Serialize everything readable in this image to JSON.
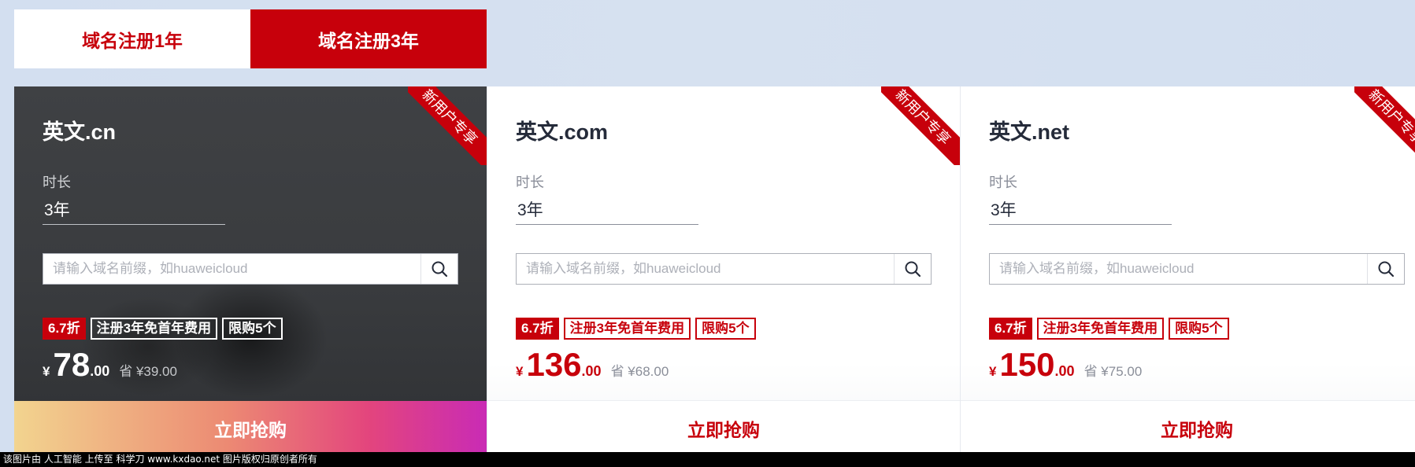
{
  "tabs": [
    {
      "label": "域名注册1年",
      "active": false
    },
    {
      "label": "域名注册3年",
      "active": true
    }
  ],
  "ribbon_text": "新用户专享",
  "duration_label": "时长",
  "search_placeholder": "请输入域名前缀，如huaweicloud",
  "buy_label": "立即抢购",
  "cards": [
    {
      "title": "英文.cn",
      "duration": "3年",
      "discount_tag": "6.7折",
      "tag_free": "注册3年免首年费用",
      "tag_limit": "限购5个",
      "currency": "¥",
      "price_int": "78",
      "price_dec": ".00",
      "save": "省 ¥39.00"
    },
    {
      "title": "英文.com",
      "duration": "3年",
      "discount_tag": "6.7折",
      "tag_free": "注册3年免首年费用",
      "tag_limit": "限购5个",
      "currency": "¥",
      "price_int": "136",
      "price_dec": ".00",
      "save": "省 ¥68.00"
    },
    {
      "title": "英文.net",
      "duration": "3年",
      "discount_tag": "6.7折",
      "tag_free": "注册3年免首年费用",
      "tag_limit": "限购5个",
      "currency": "¥",
      "price_int": "150",
      "price_dec": ".00",
      "save": "省 ¥75.00"
    }
  ],
  "footer_text": "该图片由 人工智能 上传至 科学刀 www.kxdao.net 图片版权归原创者所有",
  "colors": {
    "brand": "#c7000b",
    "background": "#d3dff0"
  }
}
